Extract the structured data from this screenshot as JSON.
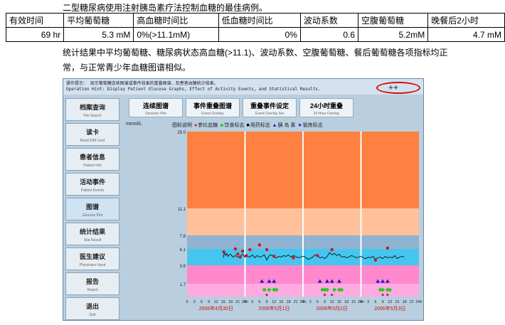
{
  "caption": "二型糖尿病使用注射胰岛素疗法控制血糖的最佳病例。",
  "table": {
    "headers": [
      "有效时间",
      "平均葡萄糖",
      "高血糖时间比",
      "低血糖时间比",
      "波动系数",
      "空腹葡萄糖",
      "晚餐后2小时"
    ],
    "values": [
      "69 hr",
      "5.3 mM",
      "0%(>11.1mM)",
      "0%",
      "0.6",
      "5.2mM",
      "4.7 mM"
    ]
  },
  "para": {
    "line1": "统计结果中平均葡萄糖、糖尿病状态高血糖(>11.1)、波动系数、空腹葡萄糖、餐后葡萄糖各项指标均正",
    "line2": "常，与正常青少年血糖图谱相似。"
  },
  "app": {
    "hint_cn": "操作提示： 显示葡萄糖连续图谱或事件效果的重叠图谱，及患者血糖统计结果。",
    "hint_en": "Operation Hint: Display Patient Glucose Graphs, Effect of Activity Events, and Statistical Results.",
    "ring_label": "++",
    "sidebar": [
      {
        "label": "档案查询",
        "en": "File Search"
      },
      {
        "label": "读卡",
        "en": "Read SIM Card"
      },
      {
        "label": "患者信息",
        "en": "Patient Info"
      },
      {
        "label": "活动事件",
        "en": "Patient Events"
      },
      {
        "label": "图谱",
        "en": "Glucose Plot"
      },
      {
        "label": "统计结果",
        "en": "Stat Result"
      },
      {
        "label": "医生建议",
        "en": "Physicians Input"
      },
      {
        "label": "报告",
        "en": "Report"
      },
      {
        "label": "退出",
        "en": "Quit"
      }
    ],
    "tabs": [
      {
        "label": "连续图谱",
        "en": "Dynamic Plot"
      },
      {
        "label": "事件重叠图谱",
        "en": "Event Overlay"
      },
      {
        "label": "重叠事件设定",
        "en": "Event Overlay Set"
      },
      {
        "label": "24小时重叠",
        "en": "24 Hour Overlay"
      }
    ],
    "legend": {
      "unit": "mmol/L",
      "title": "图标说明",
      "items": [
        "参比血糖",
        "饮食标志",
        "用药标志",
        "胰  岛  素",
        "锻炼标志"
      ],
      "colors": [
        "#e01010",
        "#22cc22",
        "#000000",
        "#1a1ad0",
        "#1a1ad0"
      ],
      "marks": [
        "●",
        "◆",
        "■",
        "▲",
        "★"
      ]
    }
  },
  "chart_data": {
    "type": "line",
    "ylabel": "mmol/L",
    "ytick_labels": [
      "25.0",
      "11.1",
      "7.8",
      "6.1",
      "3.9",
      "1.7"
    ],
    "xtick_labels": [
      "0",
      "3",
      "6",
      "9",
      "12",
      "15",
      "18",
      "21",
      "24h"
    ],
    "days": [
      "2006年4月30日",
      "2006年5月1日",
      "2006年5月2日",
      "2006年5月3日"
    ],
    "bands": [
      {
        "from": 11.1,
        "to": 25.0,
        "color": "#ff8040"
      },
      {
        "from": 7.8,
        "to": 11.1,
        "color": "#ffc09a"
      },
      {
        "from": 6.1,
        "to": 7.8,
        "color": "#8fb3d0"
      },
      {
        "from": 3.9,
        "to": 6.1,
        "color": "#44c6f0"
      },
      {
        "from": 1.7,
        "to": 3.9,
        "color": "#ff88cc"
      },
      {
        "from": 0,
        "to": 1.7,
        "color": "#ffaae0"
      }
    ],
    "glucose": [
      [
        15.0,
        4.9
      ],
      [
        15.5,
        5.7
      ],
      [
        16.0,
        5.2
      ],
      [
        16.5,
        5.5
      ],
      [
        17.0,
        5.1
      ],
      [
        17.5,
        5.3
      ],
      [
        18.0,
        5.4
      ],
      [
        19.0,
        5.0
      ],
      [
        20.0,
        5.2
      ],
      [
        21.0,
        5.0
      ],
      [
        22.0,
        5.1
      ],
      [
        23.0,
        5.4
      ],
      [
        24.0,
        5.0
      ],
      [
        25.0,
        5.1
      ],
      [
        26.0,
        5.0
      ],
      [
        27.0,
        5.3
      ],
      [
        28.0,
        4.9
      ],
      [
        29.0,
        5.2
      ],
      [
        30.0,
        5.0
      ],
      [
        31.0,
        5.1
      ],
      [
        32.0,
        5.3
      ],
      [
        33.0,
        4.6
      ],
      [
        34.0,
        5.2
      ],
      [
        35.0,
        5.3
      ],
      [
        36.0,
        5.0
      ],
      [
        37.0,
        4.9
      ],
      [
        38.0,
        5.1
      ],
      [
        39.0,
        5.0
      ],
      [
        40.0,
        5.2
      ],
      [
        41.0,
        5.1
      ],
      [
        42.0,
        5.3
      ],
      [
        43.0,
        5.0
      ],
      [
        44.0,
        5.2
      ],
      [
        45.0,
        5.1
      ],
      [
        46.0,
        4.9
      ],
      [
        47.0,
        5.0
      ],
      [
        48.0,
        5.1
      ],
      [
        49.0,
        5.0
      ],
      [
        50.0,
        4.7
      ],
      [
        51.0,
        4.8
      ],
      [
        52.0,
        5.0
      ],
      [
        53.0,
        5.3
      ],
      [
        54.0,
        5.2
      ],
      [
        55.0,
        4.9
      ],
      [
        56.0,
        5.0
      ],
      [
        57.0,
        4.8
      ],
      [
        58.0,
        5.1
      ],
      [
        59.0,
        5.6
      ],
      [
        60.0,
        5.3
      ],
      [
        61.0,
        5.5
      ],
      [
        62.0,
        5.2
      ],
      [
        63.0,
        5.4
      ],
      [
        64.0,
        5.0
      ],
      [
        65.0,
        5.1
      ],
      [
        66.0,
        4.9
      ],
      [
        67.0,
        5.0
      ],
      [
        68.0,
        5.2
      ],
      [
        69.0,
        5.1
      ],
      [
        70.0,
        4.9
      ],
      [
        71.0,
        5.0
      ],
      [
        72.0,
        5.1
      ],
      [
        73.0,
        4.9
      ],
      [
        74.0,
        4.8
      ],
      [
        75.0,
        5.0
      ],
      [
        76.0,
        4.9
      ],
      [
        77.0,
        5.1
      ],
      [
        78.0,
        4.7
      ],
      [
        79.0,
        4.9
      ],
      [
        80.0,
        5.0
      ],
      [
        81.0,
        4.8
      ],
      [
        82.0,
        5.1
      ],
      [
        83.0,
        4.9
      ],
      [
        84.0,
        5.0
      ],
      [
        85.0,
        4.9
      ],
      [
        86.0,
        5.2
      ],
      [
        87.0,
        4.8
      ],
      [
        88.0,
        5.0
      ],
      [
        89.0,
        5.1
      ],
      [
        90.0,
        5.0
      ]
    ],
    "reference_points": [
      [
        15.2,
        5.7
      ],
      [
        20.0,
        6.1
      ],
      [
        21.0,
        5.4
      ],
      [
        22.0,
        5.0
      ],
      [
        23.0,
        5.8
      ],
      [
        24.5,
        5.2
      ],
      [
        26.0,
        6.0
      ],
      [
        30.0,
        6.6
      ],
      [
        33.0,
        6.0
      ],
      [
        36.0,
        5.1
      ],
      [
        44.0,
        4.9
      ],
      [
        54.0,
        5.2
      ],
      [
        60.0,
        6.0
      ],
      [
        78.0,
        4.6
      ],
      [
        83.0,
        6.2
      ]
    ],
    "insulin_marks": [
      31,
      34,
      36,
      55,
      58,
      60,
      63,
      79,
      81,
      83
    ],
    "meal_marks": [
      32,
      34,
      36,
      37,
      56,
      57,
      58,
      61,
      63,
      64,
      80,
      81,
      83,
      84
    ],
    "exercise_marks": [
      33,
      57,
      60,
      81,
      83
    ],
    "xlim": [
      0,
      96
    ],
    "ylim": [
      0,
      25
    ]
  }
}
